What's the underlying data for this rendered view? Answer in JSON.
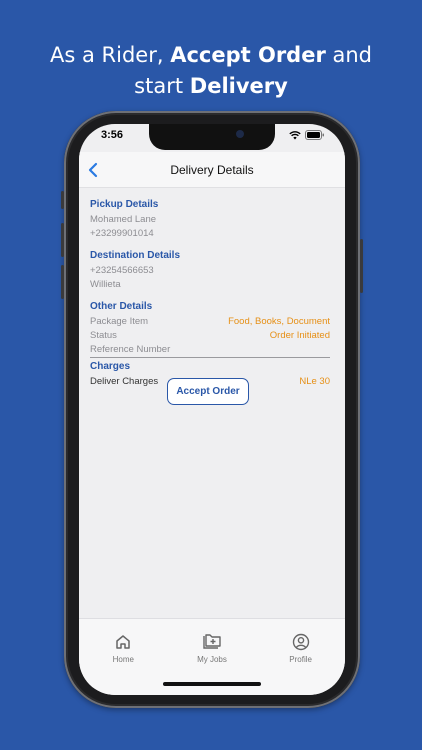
{
  "headline": {
    "line1_pre": "As a Rider, ",
    "line1_bold": "Accept Order",
    "line1_post": " and",
    "line2_pre": "start ",
    "line2_bold": "Delivery"
  },
  "status_bar": {
    "time": "3:56"
  },
  "nav": {
    "title": "Delivery Details",
    "back_icon": "chevron-left-icon"
  },
  "pickup": {
    "title": "Pickup Details",
    "name": "Mohamed Lane",
    "phone": "+23299901014"
  },
  "destination": {
    "title": "Destination Details",
    "phone": "+23254566653",
    "name": "Willieta"
  },
  "other": {
    "title": "Other Details",
    "package_label": "Package Item",
    "package_value": "Food, Books, Document",
    "status_label": "Status",
    "status_value": "Order Initiated",
    "reference_label": "Reference Number"
  },
  "charges": {
    "title": "Charges",
    "deliver_label": "Deliver Charges",
    "deliver_value": "NLe 30"
  },
  "actions": {
    "accept_label": "Accept Order"
  },
  "tabs": [
    {
      "label": "Home",
      "icon": "home-icon"
    },
    {
      "label": "My Jobs",
      "icon": "jobs-folder-icon"
    },
    {
      "label": "Profile",
      "icon": "profile-icon"
    }
  ],
  "colors": {
    "background": "#2a57a8",
    "accent": "#2a57a8",
    "value": "#e69017"
  }
}
